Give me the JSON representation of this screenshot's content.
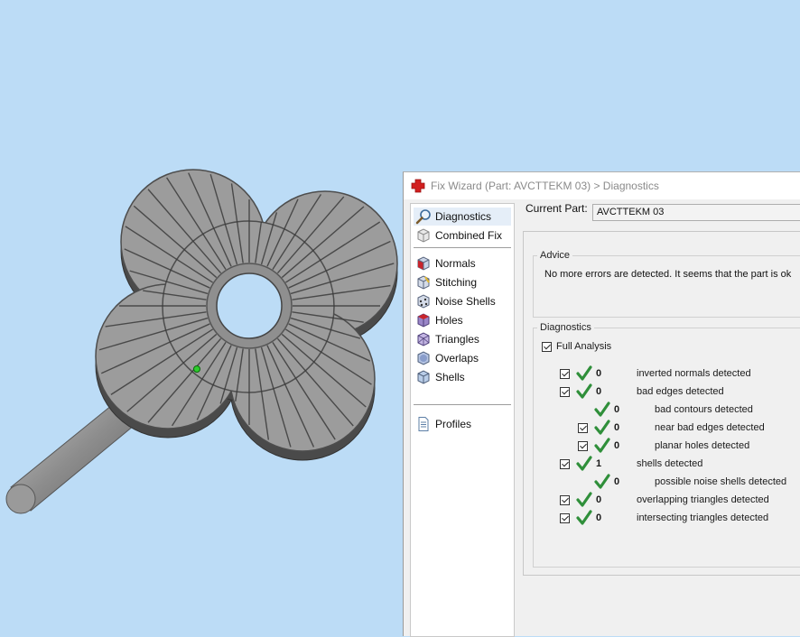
{
  "window": {
    "title": "Fix Wizard (Part: AVCTTEKM 03) > Diagnostics",
    "icon": "red-cross-icon"
  },
  "nav": {
    "items": [
      {
        "id": "diagnostics",
        "label": "Diagnostics",
        "icon": "magnifier-icon",
        "selected": true
      },
      {
        "id": "combined-fix",
        "label": "Combined Fix",
        "icon": "cube-stack-icon"
      },
      {
        "id": "normals",
        "label": "Normals",
        "icon": "normals-cube-icon"
      },
      {
        "id": "stitching",
        "label": "Stitching",
        "icon": "stitching-cube-icon"
      },
      {
        "id": "noise-shells",
        "label": "Noise Shells",
        "icon": "noise-shells-icon"
      },
      {
        "id": "holes",
        "label": "Holes",
        "icon": "holes-cube-icon"
      },
      {
        "id": "triangles",
        "label": "Triangles",
        "icon": "triangles-cube-icon"
      },
      {
        "id": "overlaps",
        "label": "Overlaps",
        "icon": "overlaps-cube-icon"
      },
      {
        "id": "shells",
        "label": "Shells",
        "icon": "shells-cube-icon"
      },
      {
        "id": "profiles",
        "label": "Profiles",
        "icon": "document-icon"
      }
    ]
  },
  "current_part": {
    "label": "Current Part:",
    "value": "AVCTTEKM 03"
  },
  "advice": {
    "legend": "Advice",
    "text": "No more errors are detected. It seems that the part is ok"
  },
  "diagnostics": {
    "legend": "Diagnostics",
    "full_analysis_label": "Full Analysis",
    "full_analysis_checked": true,
    "rows": [
      {
        "count": "0",
        "label": "inverted normals detected",
        "has_checkbox": true,
        "checked": true
      },
      {
        "count": "0",
        "label": "bad edges detected",
        "has_checkbox": true,
        "checked": true
      },
      {
        "count": "0",
        "label": "bad contours detected",
        "has_checkbox": false
      },
      {
        "count": "0",
        "label": "near bad edges detected",
        "has_checkbox": true,
        "checked": true
      },
      {
        "count": "0",
        "label": "planar holes detected",
        "has_checkbox": true,
        "checked": true
      },
      {
        "count": "1",
        "label": "shells detected",
        "has_checkbox": true,
        "checked": true
      },
      {
        "count": "0",
        "label": "possible noise shells detected",
        "has_checkbox": false
      },
      {
        "count": "0",
        "label": "overlapping triangles detected",
        "has_checkbox": true,
        "checked": true
      },
      {
        "count": "0",
        "label": "intersecting triangles detected",
        "has_checkbox": true,
        "checked": true
      }
    ]
  },
  "colors": {
    "viewport_background": "#bcdcf6",
    "part_face": "#9a9a9a",
    "check_green": "#2f8f3a",
    "brand_red": "#d21f1f"
  }
}
